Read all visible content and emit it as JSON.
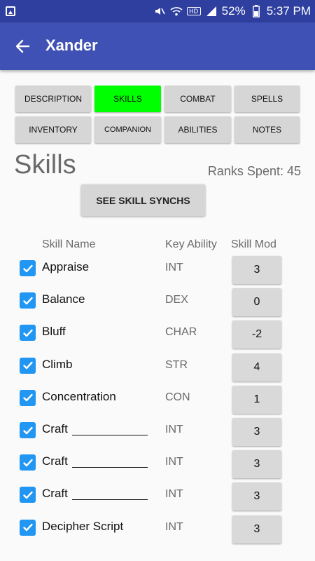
{
  "status_bar": {
    "battery": "52%",
    "time": "5:37 PM",
    "icons": [
      "gallery-icon",
      "mute-icon",
      "wifi-icon",
      "hd-icon",
      "signal-icon",
      "battery-icon"
    ]
  },
  "app_bar": {
    "title": "Xander",
    "back_icon": "arrow-back-icon"
  },
  "tabs": [
    {
      "label": "DESCRIPTION",
      "active": false
    },
    {
      "label": "SKILLS",
      "active": true
    },
    {
      "label": "COMBAT",
      "active": false
    },
    {
      "label": "SPELLS",
      "active": false
    },
    {
      "label": "INVENTORY",
      "active": false
    },
    {
      "label": "COMPANION",
      "active": false
    },
    {
      "label": "ABILITIES",
      "active": false
    },
    {
      "label": "NOTES",
      "active": false
    }
  ],
  "section": {
    "title": "Skills",
    "ranks_spent": "Ranks Spent: 45",
    "synch_button": "SEE SKILL SYNCHS"
  },
  "columns": {
    "skill_name": "Skill Name",
    "key_ability": "Key Ability",
    "skill_mod": "Skill Mod"
  },
  "skills": [
    {
      "name": "Appraise",
      "ability": "INT",
      "mod": "3",
      "checked": true
    },
    {
      "name": "Balance",
      "ability": "DEX",
      "mod": "0",
      "checked": true
    },
    {
      "name": "Bluff",
      "ability": "CHAR",
      "mod": "-2",
      "checked": true
    },
    {
      "name": "Climb",
      "ability": "STR",
      "mod": "4",
      "checked": true
    },
    {
      "name": "Concentration",
      "ability": "CON",
      "mod": "1",
      "checked": true
    },
    {
      "name": "Craft",
      "ability": "INT",
      "mod": "3",
      "checked": true
    },
    {
      "name": "Craft",
      "ability": "INT",
      "mod": "3",
      "checked": true
    },
    {
      "name": "Craft",
      "ability": "INT",
      "mod": "3",
      "checked": true
    },
    {
      "name": "Decipher Script",
      "ability": "INT",
      "mod": "3",
      "checked": true
    }
  ],
  "colors": {
    "status_bar": "#2f3f9f",
    "app_bar": "#3f51b5",
    "active_tab": "#00ff00",
    "checkbox": "#2196f3"
  }
}
